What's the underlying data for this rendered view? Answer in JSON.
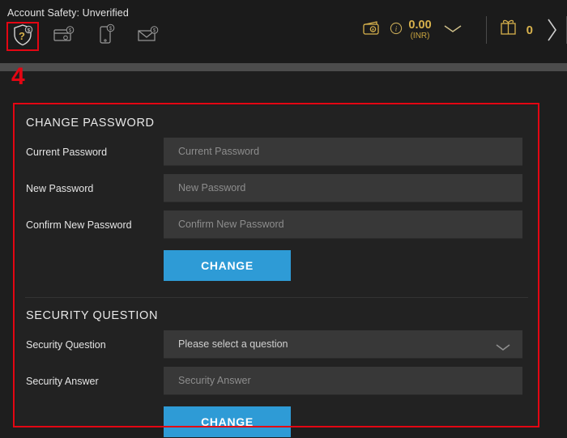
{
  "header": {
    "account_safety_text": "Account Safety: Unverified",
    "verification_icons": [
      {
        "name": "shield-question-icon",
        "highlighted": true
      },
      {
        "name": "credit-card-icon",
        "highlighted": false
      },
      {
        "name": "mobile-phone-icon",
        "highlighted": false
      },
      {
        "name": "envelope-email-icon",
        "highlighted": false
      }
    ],
    "wallet": {
      "icon": "wallet-icon",
      "info_icon": "info-circle-icon",
      "balance": "0.00",
      "currency": "(INR)",
      "expand_icon": "chevron-down-icon"
    },
    "gift": {
      "icon": "gift-box-icon",
      "count": "0"
    },
    "next_arrow_icon": "chevron-right-icon"
  },
  "annotation": {
    "number": "4",
    "color": "#e30613"
  },
  "colors": {
    "accent_blue": "#2e9bd6",
    "gold": "#d8b24c",
    "annotation_red": "#e30613",
    "panel_bg": "#222222",
    "field_bg": "#383838"
  },
  "change_password": {
    "title": "CHANGE PASSWORD",
    "fields": [
      {
        "label": "Current Password",
        "placeholder": "Current Password",
        "value": ""
      },
      {
        "label": "New Password",
        "placeholder": "New Password",
        "value": ""
      },
      {
        "label": "Confirm New Password",
        "placeholder": "Confirm New Password",
        "value": ""
      }
    ],
    "submit_label": "CHANGE"
  },
  "security_question": {
    "title": "SECURITY QUESTION",
    "select": {
      "label": "Security Question",
      "selected": "Please select a question"
    },
    "answer": {
      "label": "Security Answer",
      "placeholder": "Security Answer",
      "value": ""
    },
    "submit_label": "CHANGE"
  }
}
